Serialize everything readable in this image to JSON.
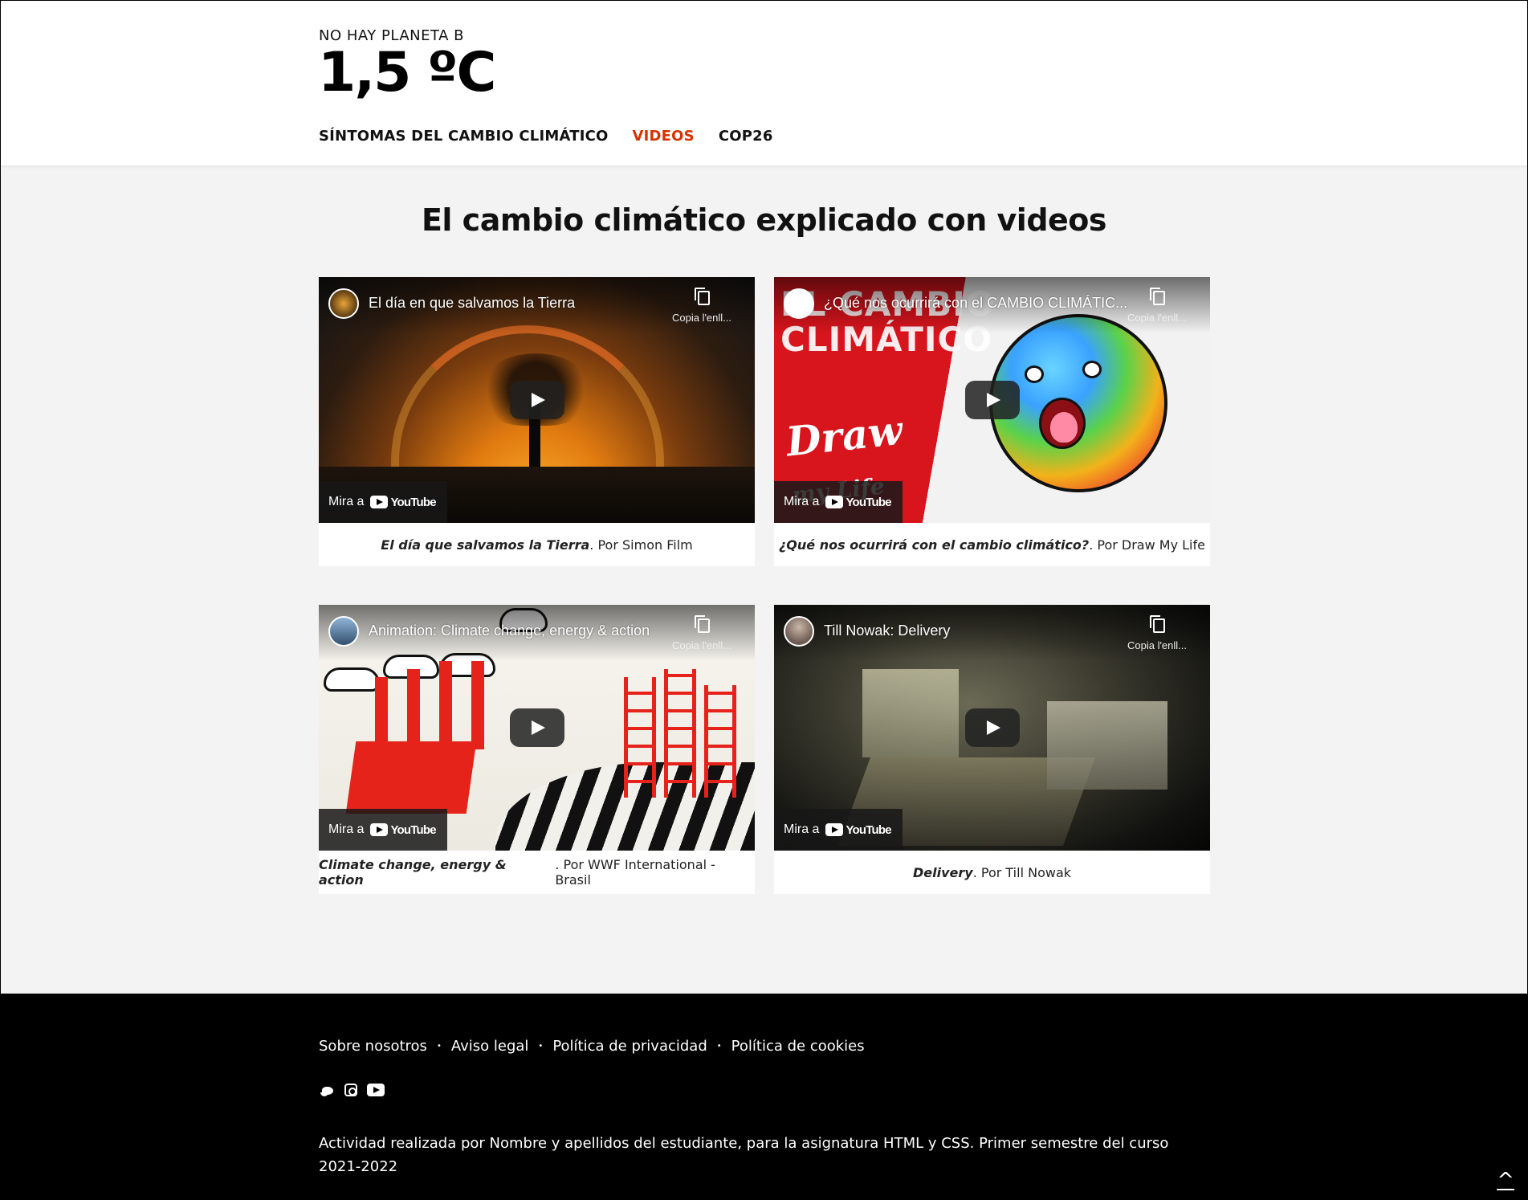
{
  "header": {
    "kicker": "NO HAY PLANETA B",
    "logo": "1,5 ºC",
    "nav": [
      {
        "label": "SÍNTOMAS DEL CAMBIO CLIMÁTICO",
        "active": false
      },
      {
        "label": "VIDEOS",
        "active": true
      },
      {
        "label": "COP26",
        "active": false
      }
    ]
  },
  "main": {
    "title": "El cambio climático explicado con videos",
    "videos": [
      {
        "embed_title": "El día en que salvamos la Tierra",
        "copy_label": "Copia l'enll...",
        "watch_label": "Mira a",
        "youtube": "YouTube",
        "caption_title": "El día que salvamos la Tierra",
        "caption_by": ". Por Simon Film"
      },
      {
        "embed_title": "¿Qué nos ocurrirá con el CAMBIO CLIMÁTIC...",
        "copy_label": "Copia l'enll...",
        "watch_label": "Mira a",
        "youtube": "YouTube",
        "caption_title": "¿Qué nos ocurrirá con el cambio climático?",
        "caption_by": ". Por Draw My Life",
        "thumb_text_1": "EL CAMBIO CLIMÁTICO",
        "thumb_text_2": "Draw my Life"
      },
      {
        "embed_title": "Animation: Climate change, energy & action",
        "copy_label": "Copia l'enll...",
        "watch_label": "Mira a",
        "youtube": "YouTube",
        "caption_title": "Climate change, energy & action",
        "caption_by": ". Por WWF International - Brasil"
      },
      {
        "embed_title": "Till Nowak: Delivery",
        "copy_label": "Copia l'enll...",
        "watch_label": "Mira a",
        "youtube": "YouTube",
        "caption_title": "Delivery",
        "caption_by": ". Por Till Nowak"
      }
    ]
  },
  "footer": {
    "links": [
      "Sobre nosotros",
      "Aviso legal",
      "Política de privacidad",
      "Política de cookies"
    ],
    "separator": "•",
    "social_icons": [
      "twitter-icon",
      "instagram-icon",
      "youtube-icon"
    ],
    "credits": "Actividad realizada por Nombre y apellidos del estudiante, para la asignatura HTML y CSS. Primer semestre del curso 2021-2022",
    "back_to_top": "^"
  },
  "colors": {
    "accent": "#d63200",
    "footer_bg": "#000000",
    "page_bg": "#f3f3f3"
  }
}
